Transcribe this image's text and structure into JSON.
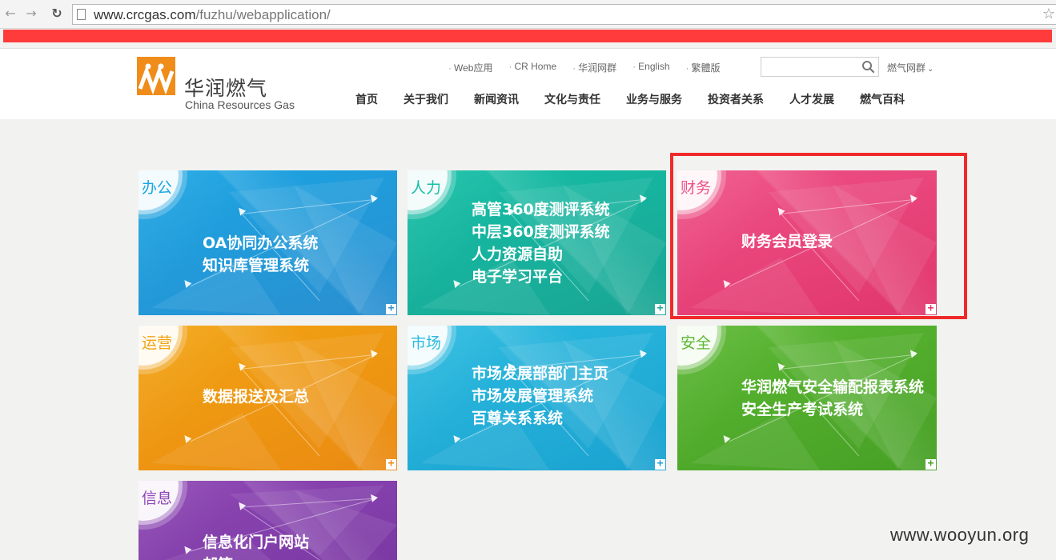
{
  "browser": {
    "url_host": "www.crcgas.com",
    "url_path": "/fuzhu/webapplication/"
  },
  "header": {
    "brand_cn": "华润燃气",
    "brand_en": "China Resources Gas",
    "util_links": [
      "Web应用",
      "CR Home",
      "华润网群",
      "English",
      "繁體版"
    ],
    "search_placeholder": "",
    "group_select": "燃气网群",
    "nav": [
      "首页",
      "关于我们",
      "新闻资讯",
      "文化与责任",
      "业务与服务",
      "投资者关系",
      "人才发展",
      "燃气百科"
    ]
  },
  "tiles": [
    {
      "category": "办公",
      "lines": [
        "OA协同办公系统",
        "知识库管理系统"
      ],
      "color": "#1aa5e3",
      "accent": "#2a8fd0"
    },
    {
      "category": "人力",
      "lines": [
        "高管360度测评系统",
        "中层360度测评系统",
        "人力资源自助",
        "电子学习平台"
      ],
      "color": "#14bfa6",
      "accent": "#1aa594"
    },
    {
      "category": "财务",
      "lines": [
        "财务会员登录"
      ],
      "color": "#ef5287",
      "accent": "#e0356d"
    },
    {
      "category": "运营",
      "lines": [
        "数据报送及汇总"
      ],
      "color": "#f2a412",
      "accent": "#ea8a12"
    },
    {
      "category": "市场",
      "lines": [
        "市场发展部部门主页",
        "市场发展管理系统",
        "百尊关系系统"
      ],
      "color": "#2cbbe0",
      "accent": "#1aa2d0"
    },
    {
      "category": "安全",
      "lines": [
        "华润燃气安全输配报表系统",
        "安全生产考试系统"
      ],
      "color": "#5cb833",
      "accent": "#46a025"
    },
    {
      "category": "信息",
      "lines": [
        "信息化门户网站",
        "邮箱"
      ],
      "color": "#8e47b4",
      "accent": "#7a38a3"
    }
  ],
  "watermark": "www.wooyun.org"
}
